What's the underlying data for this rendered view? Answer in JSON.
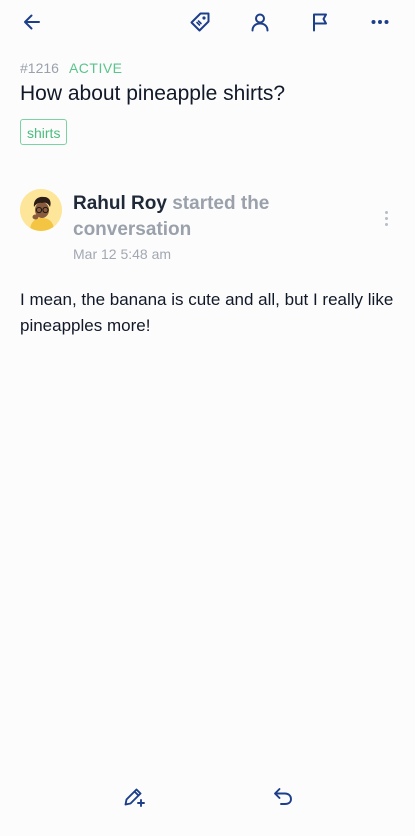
{
  "toolbar": {
    "back_icon": "arrow-left-icon",
    "tag_icon": "tag-icon",
    "assign_icon": "user-icon",
    "flag_icon": "flag-icon",
    "more_icon": "more-horizontal-icon",
    "icon_color": "#1d3f8a"
  },
  "ticket": {
    "id": "#1216",
    "status": "ACTIVE",
    "title": "How about pineapple shirts?",
    "tag": "shirts"
  },
  "message": {
    "author": "Rahul Roy",
    "action": "started the conversation",
    "timestamp": "Mar 12 5:48 am",
    "body": "I mean, the banana is cute and all, but I really like pineapples more!"
  },
  "bottom_bar": {
    "compose_icon": "pencil-plus-icon",
    "reply_icon": "reply-icon"
  },
  "colors": {
    "status_green": "#5ac58a",
    "muted_gray": "#9aa1ab",
    "avatar_bg": "#fde69a"
  }
}
